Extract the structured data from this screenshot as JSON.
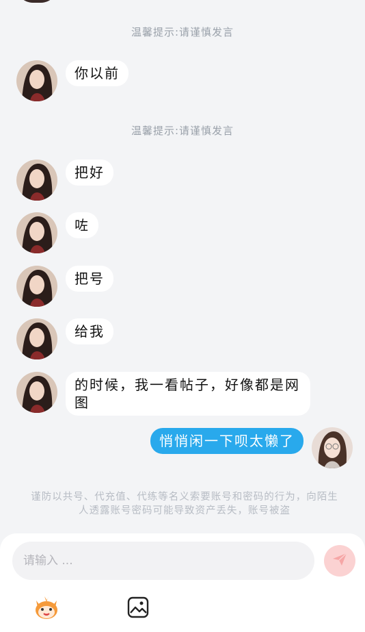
{
  "system_tip": "温馨提示:请谨慎发言",
  "messages": [
    {
      "text": "你以前"
    },
    {
      "text": "把好"
    },
    {
      "text": "咗"
    },
    {
      "text": "把号"
    },
    {
      "text": "给我"
    },
    {
      "text": "的时候，我一看帖子，好像都是网图"
    },
    {
      "text": "悄悄闲一下呗太懒了"
    }
  ],
  "notice": "谨防以共号、代充值、代练等名义索要账号和密码的行为，向陌生人透露账号密码可能导致资产丢失，账号被盗",
  "composer": {
    "placeholder": "请输入 ..."
  },
  "icons": {
    "send": "send-icon",
    "emoji": "mascot-emoji-icon",
    "image": "image-icon"
  },
  "colors": {
    "my_bubble": "#29a9ec",
    "send_button": "#fbd2d2"
  }
}
